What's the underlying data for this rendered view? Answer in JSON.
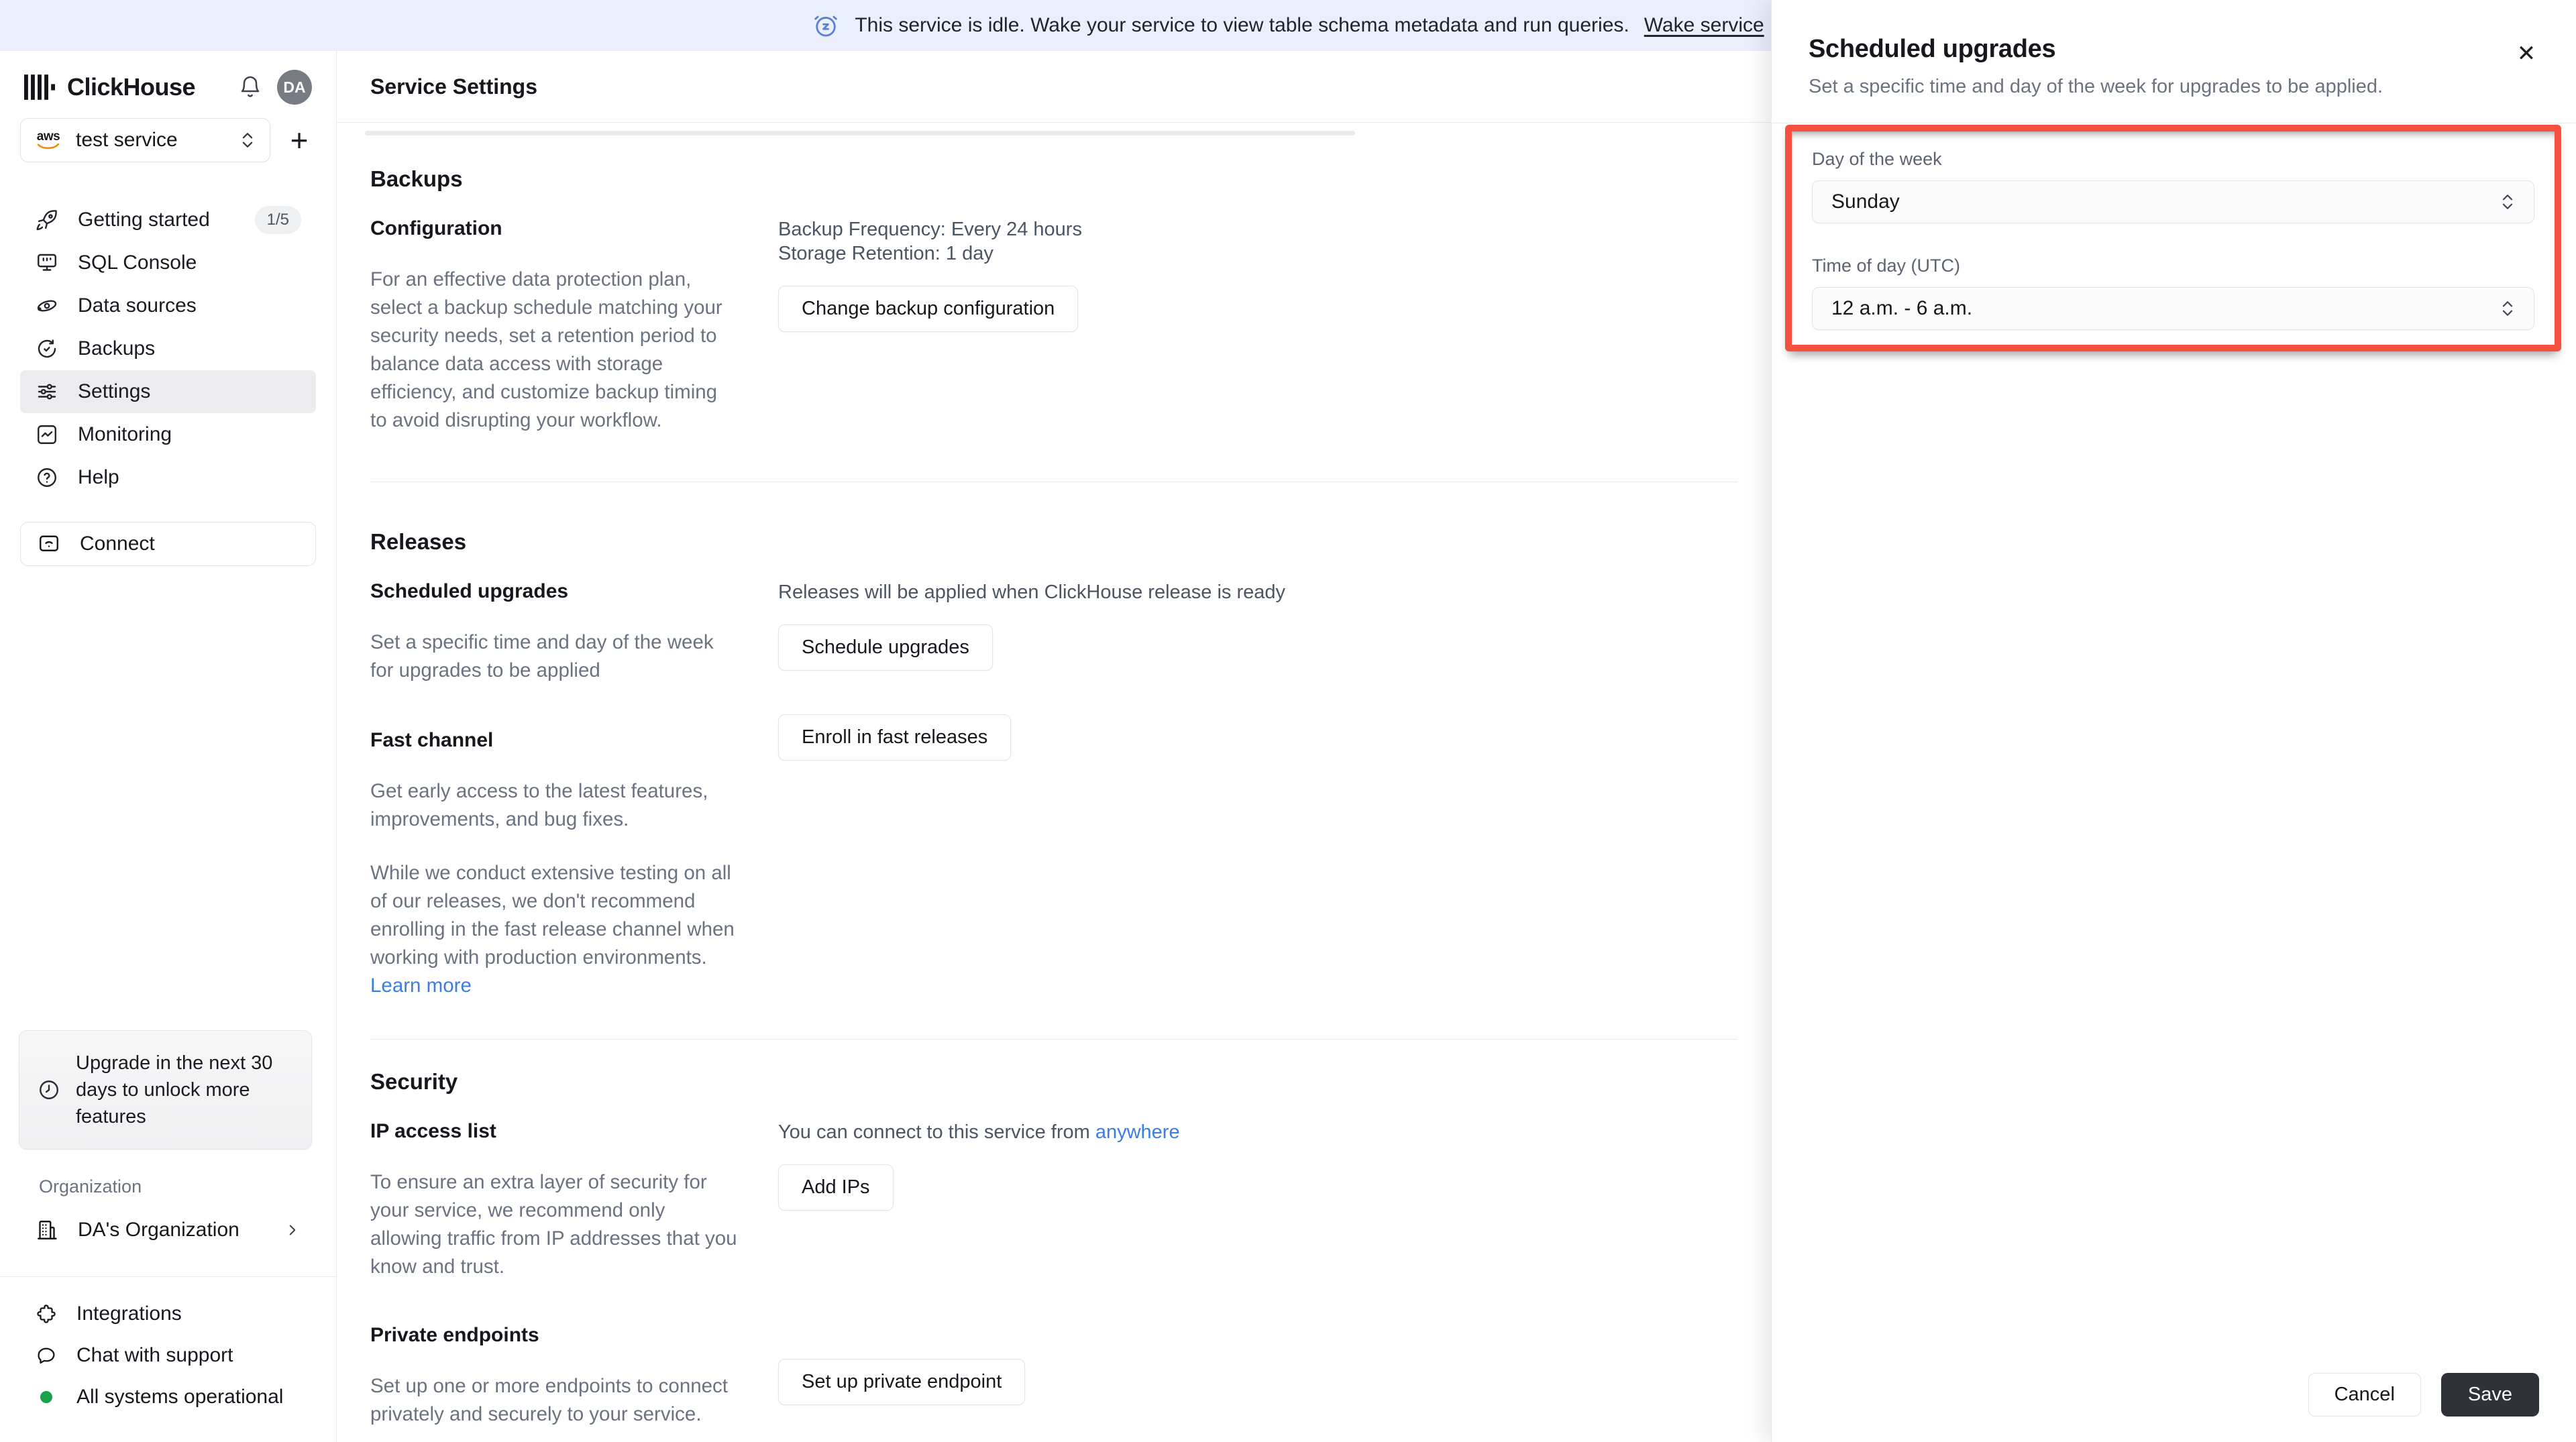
{
  "banner": {
    "icon": "alarm-snooze-icon",
    "text": "This service is idle. Wake your service to view table schema metadata and run queries.",
    "link": "Wake service"
  },
  "sidebar": {
    "brand": "ClickHouse",
    "avatar_initials": "DA",
    "service_selector": {
      "provider": "aws",
      "name": "test service"
    },
    "add_service_label": "+",
    "nav": [
      {
        "label": "Getting started",
        "icon": "rocket-icon",
        "badge": "1/5"
      },
      {
        "label": "SQL Console",
        "icon": "console-icon"
      },
      {
        "label": "Data sources",
        "icon": "data-sources-icon"
      },
      {
        "label": "Backups",
        "icon": "backups-icon"
      },
      {
        "label": "Settings",
        "icon": "settings-icon",
        "active": true
      },
      {
        "label": "Monitoring",
        "icon": "monitoring-icon"
      },
      {
        "label": "Help",
        "icon": "help-icon"
      }
    ],
    "connect_label": "Connect",
    "upgrade_notice": "Upgrade in the next 30 days to unlock more features",
    "organization_label": "Organization",
    "organization_name": "DA's Organization",
    "footer": [
      {
        "label": "Integrations",
        "icon": "puzzle-icon"
      },
      {
        "label": "Chat with support",
        "icon": "chat-icon"
      }
    ],
    "status": "All systems operational"
  },
  "main": {
    "title": "Service Settings",
    "backups": {
      "heading": "Backups",
      "item_label": "Configuration",
      "frequency": "Backup Frequency: Every 24 hours",
      "retention": "Storage Retention: 1 day",
      "button": "Change backup configuration",
      "description": "For an effective data protection plan, select a backup schedule matching your security needs, set a retention period to balance data access with storage efficiency, and customize backup timing to avoid disrupting your workflow."
    },
    "releases": {
      "heading": "Releases",
      "scheduled": {
        "label": "Scheduled upgrades",
        "note": "Releases will be applied when ClickHouse release is ready",
        "button": "Schedule upgrades",
        "description": "Set a specific time and day of the week for upgrades to be applied"
      },
      "fast": {
        "label": "Fast channel",
        "button": "Enroll in fast releases",
        "description1": "Get early access to the latest features, improvements, and bug fixes.",
        "description2": "While we conduct extensive testing on all of our releases, we don't recommend enrolling in the fast release channel when working with production environments.",
        "link": "Learn more"
      }
    },
    "security": {
      "heading": "Security",
      "ip": {
        "label": "IP access list",
        "note_prefix": "You can connect to this service from",
        "note_link": "anywhere",
        "button": "Add IPs",
        "description": "To ensure an extra layer of security for your service, we recommend only allowing traffic from IP addresses that you know and trust."
      },
      "private": {
        "label": "Private endpoints",
        "button": "Set up private endpoint",
        "description": "Set up one or more endpoints to connect privately and securely to your service."
      }
    }
  },
  "drawer": {
    "title": "Scheduled upgrades",
    "subtitle": "Set a specific time and day of the week for upgrades to be applied.",
    "day_label": "Day of the week",
    "day_value": "Sunday",
    "time_label": "Time of day (UTC)",
    "time_value": "12 a.m. - 6 a.m.",
    "cancel_label": "Cancel",
    "save_label": "Save"
  },
  "colors": {
    "annotation_red": "#f4513e",
    "banner_bg": "#ebeffc",
    "link_blue": "#3e7de0",
    "save_bg": "#303239",
    "status_green": "#18a34b"
  }
}
